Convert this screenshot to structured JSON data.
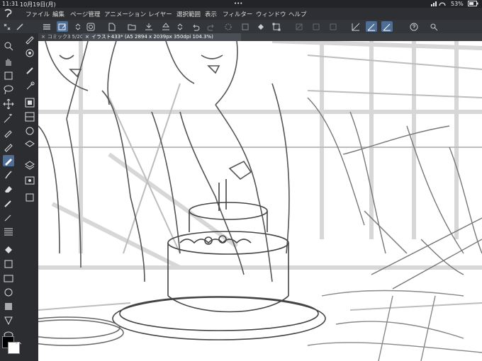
{
  "status": {
    "time": "11:31",
    "date": "10月19日(月)",
    "battery": "53%",
    "dots": "•••"
  },
  "menu": {
    "items": [
      "ファイル",
      "編集",
      "ページ管理",
      "アニメーション",
      "レイヤー",
      "選択範囲",
      "表示",
      "フィルター",
      "ウィンドウ",
      "ヘルプ"
    ]
  },
  "tabs": [
    {
      "label": "コミック3 5/20"
    },
    {
      "label": "イラスト433* (A5 2894 x 2039px 350dpi 104.3%)"
    }
  ],
  "colors": {
    "main": "#000000",
    "sub": "#ffffff",
    "accent": "#4f6e95"
  }
}
